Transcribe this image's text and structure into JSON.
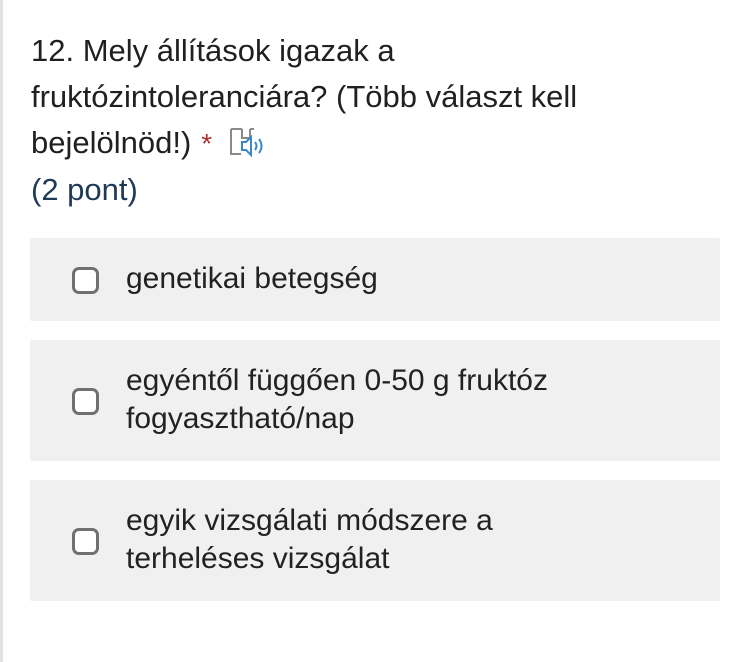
{
  "question": {
    "line1": "12. Mely állítások igazak a",
    "line2": "fruktózintoleranciára? (Több választ kell",
    "line3": "bejelölnöd!)",
    "required_marker": "*",
    "points": "(2 pont)",
    "speaker_icon": "read-aloud-speaker-icon"
  },
  "options": [
    {
      "line1": "genetikai betegség",
      "line2": "",
      "checked": false
    },
    {
      "line1": "egyéntől függően 0-50 g fruktóz",
      "line2": "fogyasztható/nap",
      "checked": false
    },
    {
      "line1": "egyik vizsgálati módszere a",
      "line2": "terheléses vizsgálat",
      "checked": false
    }
  ],
  "colors": {
    "option_background": "#f0f0f0",
    "checkbox_border": "#707070",
    "required_star": "#b03030",
    "points_text": "#1f3a56",
    "speaker_accent": "#3a86c8"
  }
}
